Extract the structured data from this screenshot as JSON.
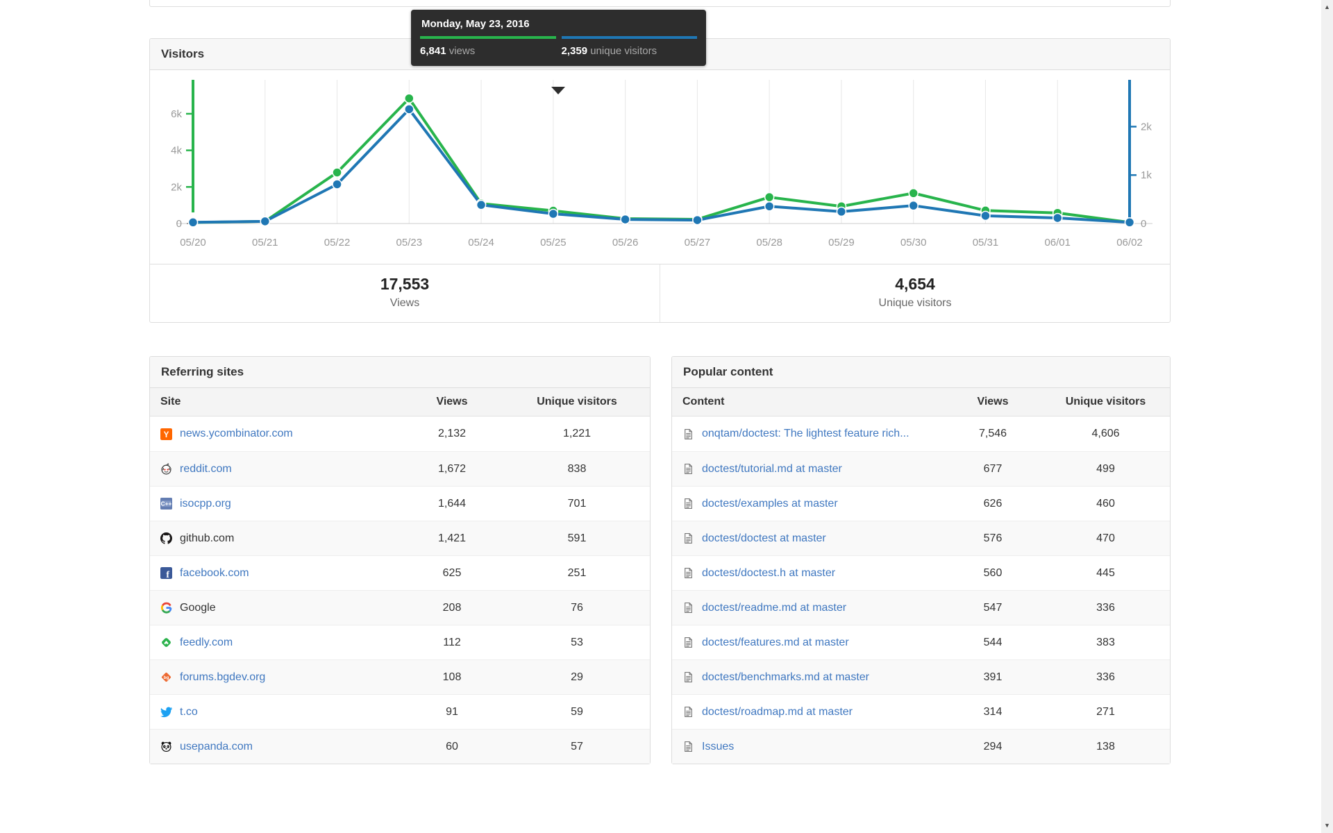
{
  "tooltip": {
    "title": "Monday, May 23, 2016",
    "views_value": "6,841",
    "views_label": "views",
    "unique_value": "2,359",
    "unique_label": "unique visitors"
  },
  "visitors_panel": {
    "title": "Visitors",
    "summary": {
      "views_value": "17,553",
      "views_label": "Views",
      "unique_value": "4,654",
      "unique_label": "Unique visitors"
    }
  },
  "chart_data": {
    "type": "line",
    "x": [
      "05/20",
      "05/21",
      "05/22",
      "05/23",
      "05/24",
      "05/25",
      "05/26",
      "05/27",
      "05/28",
      "05/29",
      "05/30",
      "05/31",
      "06/01",
      "06/02"
    ],
    "series": [
      {
        "name": "views",
        "axis": "left",
        "color": "#28b44c",
        "values": [
          55,
          120,
          2790,
          6841,
          1090,
          700,
          265,
          230,
          1440,
          940,
          1660,
          710,
          580,
          60
        ]
      },
      {
        "name": "unique visitors",
        "axis": "right",
        "color": "#1f77b4",
        "values": [
          25,
          45,
          810,
          2359,
          385,
          200,
          85,
          70,
          355,
          245,
          370,
          160,
          115,
          25
        ]
      }
    ],
    "left_axis": {
      "color": "#28b44c",
      "max": 7855,
      "zero_label": "0",
      "ticks": [
        {
          "v": 2000,
          "label": "2k"
        },
        {
          "v": 4000,
          "label": "4k"
        },
        {
          "v": 6000,
          "label": "6k"
        }
      ]
    },
    "right_axis": {
      "color": "#1f77b4",
      "max": 2966,
      "zero_label": "0",
      "ticks": [
        {
          "v": 1000,
          "label": "1k"
        },
        {
          "v": 2000,
          "label": "2k"
        }
      ]
    },
    "grid": true,
    "legend": "none",
    "highlighted_point": {
      "x": "05/23",
      "views": 6841,
      "unique_visitors": 2359
    }
  },
  "referring": {
    "title": "Referring sites",
    "columns": [
      "Site",
      "Views",
      "Unique visitors"
    ],
    "rows": [
      {
        "site": "news.ycombinator.com",
        "views": "2,132",
        "unique": "1,221",
        "icon": "ycombinator-icon",
        "link": true
      },
      {
        "site": "reddit.com",
        "views": "1,672",
        "unique": "838",
        "icon": "reddit-icon",
        "link": true
      },
      {
        "site": "isocpp.org",
        "views": "1,644",
        "unique": "701",
        "icon": "isocpp-icon",
        "link": true
      },
      {
        "site": "github.com",
        "views": "1,421",
        "unique": "591",
        "icon": "github-icon",
        "link": false
      },
      {
        "site": "facebook.com",
        "views": "625",
        "unique": "251",
        "icon": "facebook-icon",
        "link": true
      },
      {
        "site": "Google",
        "views": "208",
        "unique": "76",
        "icon": "google-icon",
        "link": false
      },
      {
        "site": "feedly.com",
        "views": "112",
        "unique": "53",
        "icon": "feedly-icon",
        "link": true
      },
      {
        "site": "forums.bgdev.org",
        "views": "108",
        "unique": "29",
        "icon": "bgdev-icon",
        "link": true
      },
      {
        "site": "t.co",
        "views": "91",
        "unique": "59",
        "icon": "twitter-icon",
        "link": true
      },
      {
        "site": "usepanda.com",
        "views": "60",
        "unique": "57",
        "icon": "panda-icon",
        "link": true
      }
    ]
  },
  "popular": {
    "title": "Popular content",
    "columns": [
      "Content",
      "Views",
      "Unique visitors"
    ],
    "rows": [
      {
        "content": "onqtam/doctest: The lightest feature rich...",
        "views": "7,546",
        "unique": "4,606"
      },
      {
        "content": "doctest/tutorial.md at master",
        "views": "677",
        "unique": "499"
      },
      {
        "content": "doctest/examples at master",
        "views": "626",
        "unique": "460"
      },
      {
        "content": "doctest/doctest at master",
        "views": "576",
        "unique": "470"
      },
      {
        "content": "doctest/doctest.h at master",
        "views": "560",
        "unique": "445"
      },
      {
        "content": "doctest/readme.md at master",
        "views": "547",
        "unique": "336"
      },
      {
        "content": "doctest/features.md at master",
        "views": "544",
        "unique": "383"
      },
      {
        "content": "doctest/benchmarks.md at master",
        "views": "391",
        "unique": "336"
      },
      {
        "content": "doctest/roadmap.md at master",
        "views": "314",
        "unique": "271"
      },
      {
        "content": "Issues",
        "views": "294",
        "unique": "138"
      }
    ]
  },
  "icons": {
    "scroll_up": "▲",
    "scroll_down": "▼"
  }
}
